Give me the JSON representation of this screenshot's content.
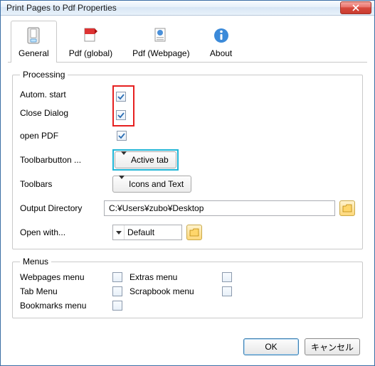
{
  "window": {
    "title": "Print Pages to Pdf Properties"
  },
  "tabs": {
    "general": "General",
    "pdf_global": "Pdf (global)",
    "pdf_webpage": "Pdf (Webpage)",
    "about": "About"
  },
  "processing": {
    "legend": "Processing",
    "autom_start": "Autom. start",
    "close_dialog": "Close Dialog",
    "open_pdf": "open PDF",
    "toolbarbutton_label": "Toolbarbutton ...",
    "toolbarbutton_value": "Active tab",
    "toolbars_label": "Toolbars",
    "toolbars_value": "Icons and Text",
    "output_dir_label": "Output Directory",
    "output_dir_value": "C:¥Users¥zubo¥Desktop",
    "open_with_label": "Open with...",
    "open_with_value": "Default"
  },
  "menus": {
    "legend": "Menus",
    "webpages": "Webpages menu",
    "extras": "Extras menu",
    "tabmenu": "Tab Menu",
    "scrapbook": "Scrapbook menu",
    "bookmarks": "Bookmarks menu"
  },
  "buttons": {
    "ok": "OK",
    "cancel": "キャンセル"
  }
}
